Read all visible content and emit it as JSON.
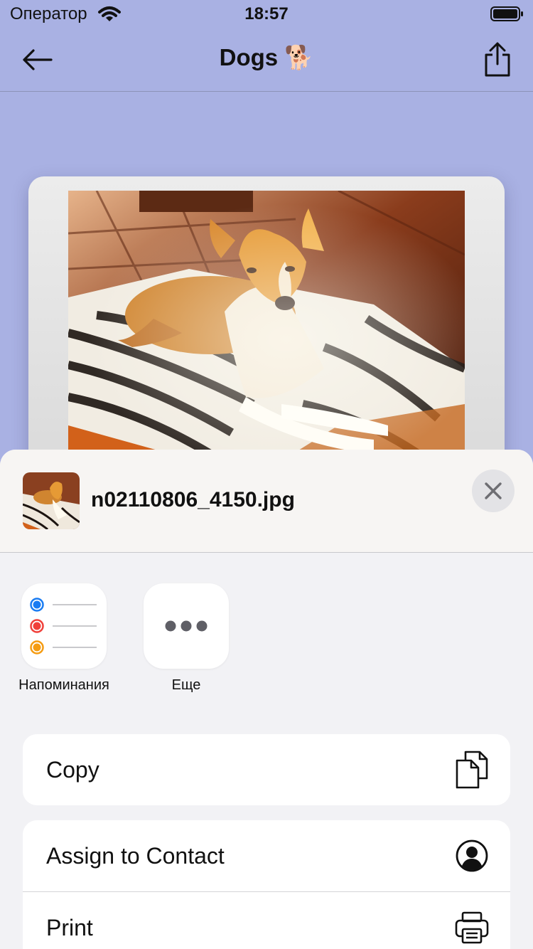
{
  "status_bar": {
    "carrier": "Оператор",
    "time": "18:57"
  },
  "nav": {
    "title": "Dogs 🐕"
  },
  "share_sheet": {
    "file_name": "n02110806_4150.jpg",
    "apps": [
      {
        "label": "Напоминания",
        "icon": "reminders-icon"
      },
      {
        "label": "Еще",
        "icon": "more-icon"
      }
    ],
    "actions": [
      {
        "label": "Copy",
        "icon": "copy-icon"
      },
      {
        "label": "Assign to Contact",
        "icon": "contact-icon"
      },
      {
        "label": "Print",
        "icon": "print-icon"
      }
    ]
  }
}
